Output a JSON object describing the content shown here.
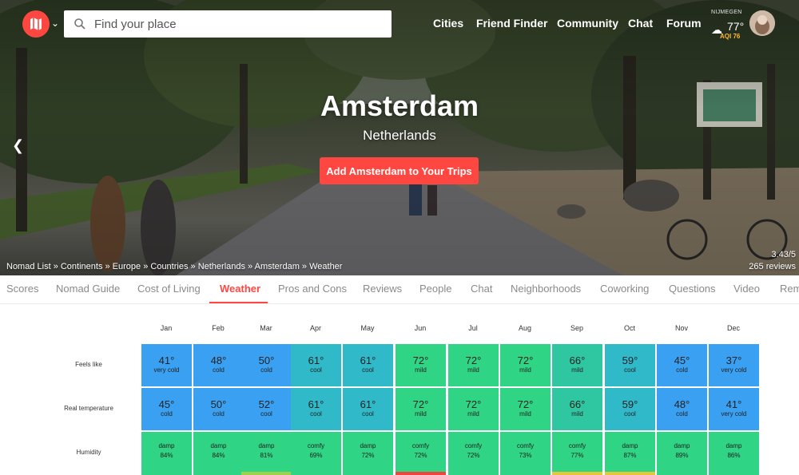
{
  "header": {
    "search": {
      "placeholder": "Find your place"
    },
    "nav": [
      "Cities",
      "Friend Finder",
      "Community",
      "Chat",
      "Forum"
    ],
    "weather_widget": {
      "city": "NIJMEGEN",
      "temp": "77°",
      "aqi": "AQI 76"
    }
  },
  "hero": {
    "title": "Amsterdam",
    "subtitle": "Netherlands",
    "cta": "Add Amsterdam to Your Trips",
    "breadcrumb": "Nomad List » Continents » Europe » Countries  » Netherlands » Amsterdam » Weather",
    "rating": "3.43/5",
    "reviews": "265 reviews"
  },
  "tabs": [
    "Scores",
    "Nomad Guide",
    "Cost of Living",
    "Weather",
    "Pros and Cons",
    "Reviews",
    "People",
    "Chat",
    "Neighborhoods",
    "Coworking",
    "Questions",
    "Video",
    "Rem"
  ],
  "active_tab": "Weather",
  "weather": {
    "months": [
      "Jan",
      "Feb",
      "Mar",
      "Apr",
      "May",
      "Jun",
      "Jul",
      "Aug",
      "Sep",
      "Oct",
      "Nov",
      "Dec"
    ],
    "rows": [
      {
        "label": "Feels like",
        "cells": [
          {
            "value": "41°",
            "desc": "very cold",
            "color": "#3aa0f2"
          },
          {
            "value": "48°",
            "desc": "cold",
            "color": "#3aa0f2"
          },
          {
            "value": "50°",
            "desc": "cold",
            "color": "#3aa0f2"
          },
          {
            "value": "61°",
            "desc": "cool",
            "color": "#30b9c9"
          },
          {
            "value": "61°",
            "desc": "cool",
            "color": "#30b9c9"
          },
          {
            "value": "72°",
            "desc": "mild",
            "color": "#2fd484"
          },
          {
            "value": "72°",
            "desc": "mild",
            "color": "#2fd484"
          },
          {
            "value": "72°",
            "desc": "mild",
            "color": "#2fd484"
          },
          {
            "value": "66°",
            "desc": "mild",
            "color": "#2fc7a2"
          },
          {
            "value": "59°",
            "desc": "cool",
            "color": "#30b9c9"
          },
          {
            "value": "45°",
            "desc": "cold",
            "color": "#3aa0f2"
          },
          {
            "value": "37°",
            "desc": "very cold",
            "color": "#3aa0f2"
          }
        ]
      },
      {
        "label": "Real temperature",
        "cells": [
          {
            "value": "45°",
            "desc": "cold",
            "color": "#3aa0f2"
          },
          {
            "value": "50°",
            "desc": "cold",
            "color": "#3aa0f2"
          },
          {
            "value": "52°",
            "desc": "cool",
            "color": "#3aa0f2"
          },
          {
            "value": "61°",
            "desc": "cool",
            "color": "#30b9c9"
          },
          {
            "value": "61°",
            "desc": "cool",
            "color": "#30b9c9"
          },
          {
            "value": "72°",
            "desc": "mild",
            "color": "#2fd484"
          },
          {
            "value": "72°",
            "desc": "mild",
            "color": "#2fd484"
          },
          {
            "value": "72°",
            "desc": "mild",
            "color": "#2fd484"
          },
          {
            "value": "66°",
            "desc": "mild",
            "color": "#2fc7a2"
          },
          {
            "value": "59°",
            "desc": "cool",
            "color": "#30b9c9"
          },
          {
            "value": "48°",
            "desc": "cold",
            "color": "#3aa0f2"
          },
          {
            "value": "41°",
            "desc": "very cold",
            "color": "#3aa0f2"
          }
        ]
      },
      {
        "label": "Humidity",
        "cells": [
          {
            "value": "damp",
            "desc": "84%",
            "color": "#2fd484"
          },
          {
            "value": "damp",
            "desc": "84%",
            "color": "#2fd484"
          },
          {
            "value": "damp",
            "desc": "81%",
            "color": "#2fd484"
          },
          {
            "value": "comfy",
            "desc": "69%",
            "color": "#2fd484"
          },
          {
            "value": "damp",
            "desc": "72%",
            "color": "#2fd484"
          },
          {
            "value": "comfy",
            "desc": "72%",
            "color": "#2fd484"
          },
          {
            "value": "comfy",
            "desc": "72%",
            "color": "#2fd484"
          },
          {
            "value": "comfy",
            "desc": "73%",
            "color": "#2fd484"
          },
          {
            "value": "comfy",
            "desc": "77%",
            "color": "#2fd484"
          },
          {
            "value": "damp",
            "desc": "87%",
            "color": "#2fd484"
          },
          {
            "value": "damp",
            "desc": "89%",
            "color": "#2fd484"
          },
          {
            "value": "damp",
            "desc": "86%",
            "color": "#2fd484"
          }
        ]
      }
    ],
    "next_row_colors": [
      "#2fd484",
      "#2fd484",
      "#9fd24a",
      "#2fd484",
      "#2fd484",
      "#f0453d",
      "#2fd484",
      "#2fd484",
      "#e7c73a",
      "#e7c73a",
      "#2fd484",
      "#2fd484"
    ]
  },
  "colors": {
    "brand": "#ff4742",
    "active_tab": "#ff4742"
  }
}
